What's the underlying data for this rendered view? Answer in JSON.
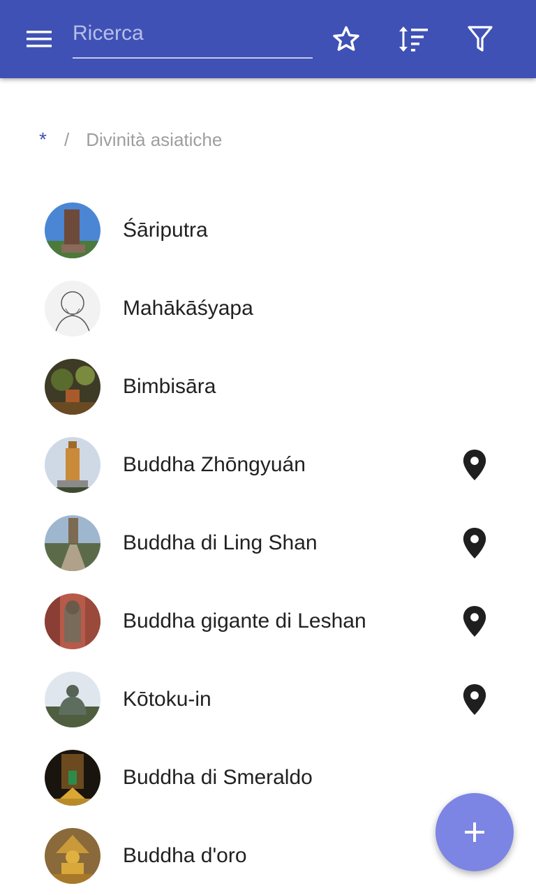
{
  "toolbar": {
    "menu_icon": "hamburger-menu-icon",
    "search_placeholder": "Ricerca",
    "search_value": "",
    "favorite_icon": "star-outline-icon",
    "sort_icon": "sort-icon",
    "filter_icon": "filter-icon",
    "color": "#3f51b5"
  },
  "breadcrumb": {
    "root": "*",
    "separator": "/",
    "current": "Divinità asiatiche"
  },
  "items": [
    {
      "label": "Śāriputra",
      "has_location": false
    },
    {
      "label": "Mahākāśyapa",
      "has_location": false
    },
    {
      "label": "Bimbisāra",
      "has_location": false
    },
    {
      "label": "Buddha Zhōngyuán",
      "has_location": true
    },
    {
      "label": "Buddha di Ling Shan",
      "has_location": true
    },
    {
      "label": "Buddha gigante di Leshan",
      "has_location": true
    },
    {
      "label": "Kōtoku-in",
      "has_location": true
    },
    {
      "label": "Buddha di Smeraldo",
      "has_location": false
    },
    {
      "label": "Buddha d'oro",
      "has_location": false
    }
  ],
  "fab": {
    "icon": "plus-icon",
    "color": "#7c85e4"
  }
}
